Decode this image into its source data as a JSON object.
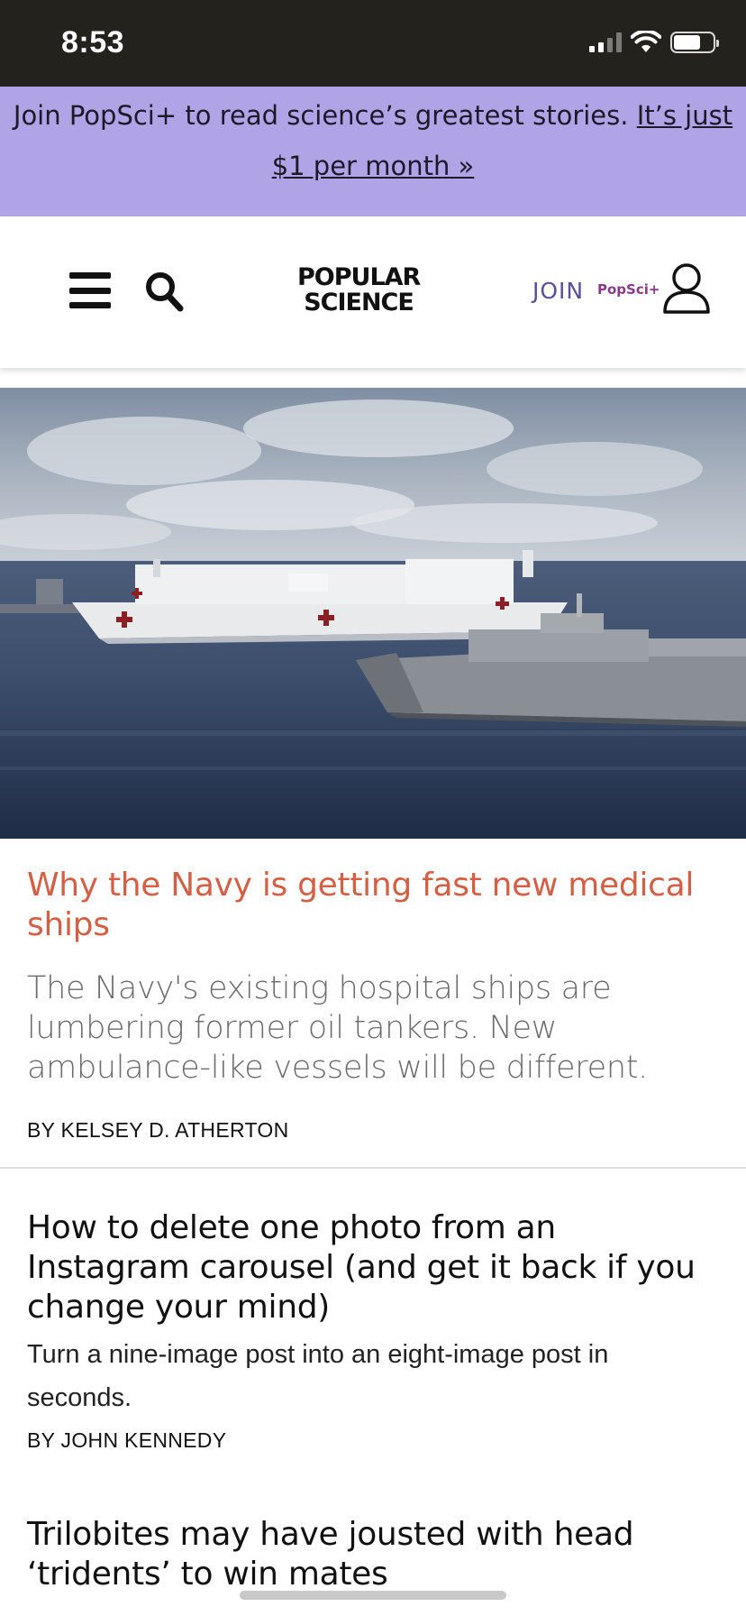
{
  "status_bar": {
    "time": "8:53",
    "icons": [
      "cellular-signal-icon",
      "wifi-icon",
      "battery-icon"
    ]
  },
  "promo": {
    "text": "Join PopSci+ to read science’s greatest stories. ",
    "link": "It’s just $1 per month »",
    "background": "#b1a4e6"
  },
  "header": {
    "logo_line1": "POPULAR",
    "logo_line2": "SCIENCE",
    "join_label": "JOIN",
    "join_brand": "PopSci+",
    "menu_icon": "hamburger-icon",
    "search_icon": "search-icon",
    "account_icon": "user-icon",
    "join_color": "#5a4e9e"
  },
  "articles": [
    {
      "title": "Why the Navy is getting fast new medical ships",
      "dek": "The Navy's existing hospital ships are lumbering former oil tankers. New ambulance-like vessels will be different.",
      "byline": "BY KELSEY D. ATHERTON",
      "title_color": "#d35f45"
    },
    {
      "title": "How to delete one photo from an Instagram carousel (and get it back if you change your mind)",
      "dek": "Turn a nine-image post into an eight-image post in seconds.",
      "byline": "BY JOHN KENNEDY"
    },
    {
      "title": "Trilobites may have jousted with head ‘tridents’ to win mates"
    }
  ]
}
